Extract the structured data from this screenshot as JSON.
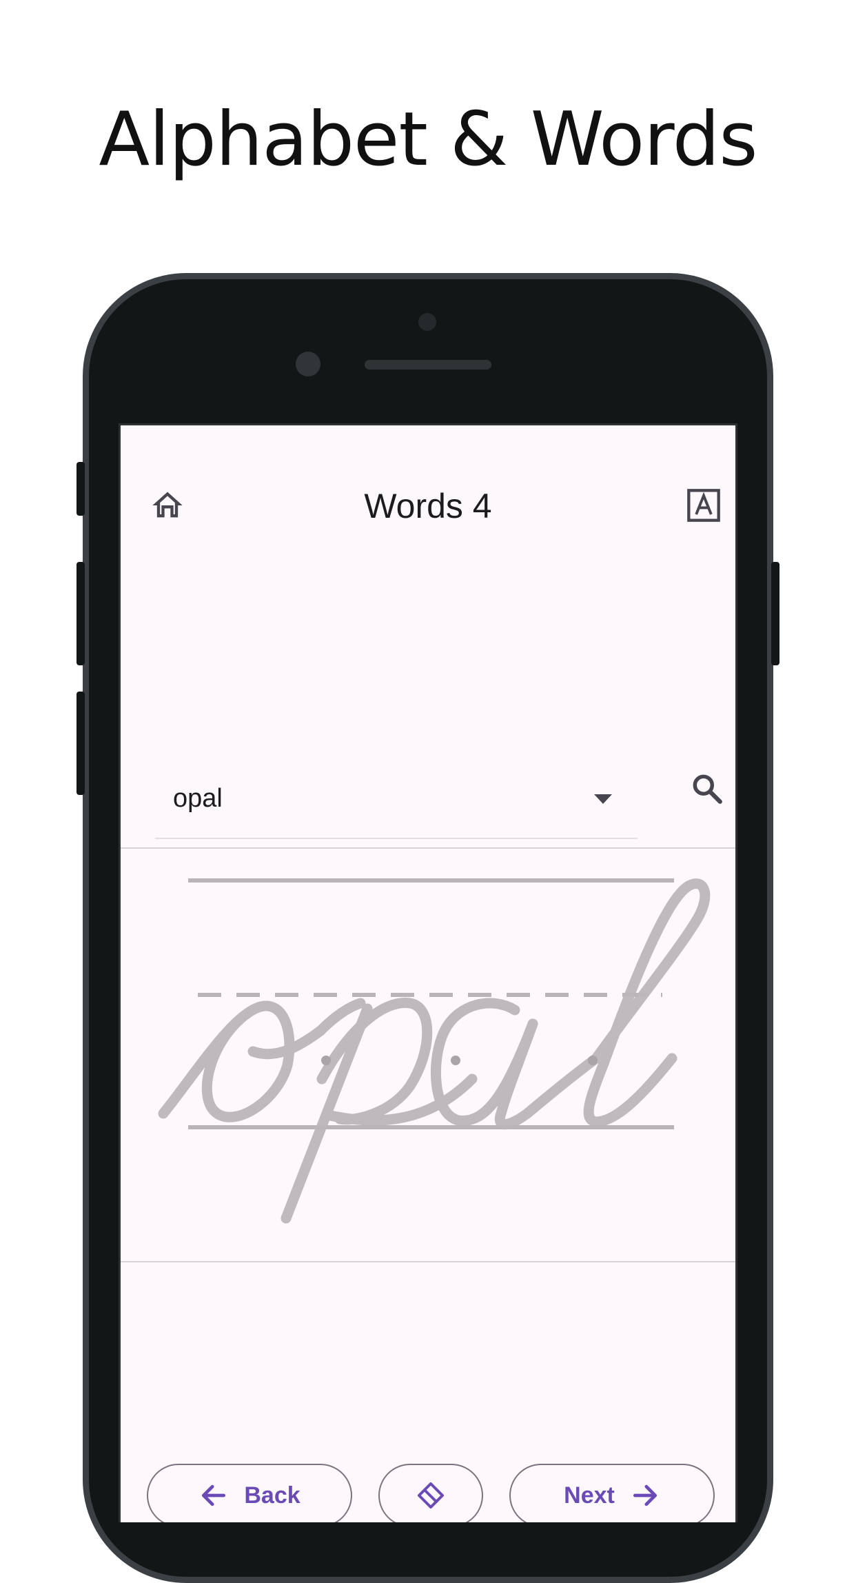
{
  "headline": "Alphabet & Words",
  "app": {
    "title": "Words 4",
    "icons": {
      "home": "home-icon",
      "font": "font-style-icon",
      "search": "search-icon",
      "dropdown": "dropdown-arrow-icon",
      "eraser": "eraser-icon"
    },
    "word_selector": {
      "value": "opal"
    },
    "practice_word": "opal",
    "buttons": {
      "back": "Back",
      "next": "Next"
    },
    "colors": {
      "accent": "#6a4bb5",
      "trace": "#bab6ba",
      "guideline": "#b8b4b8",
      "background": "#fdf8fc"
    }
  }
}
